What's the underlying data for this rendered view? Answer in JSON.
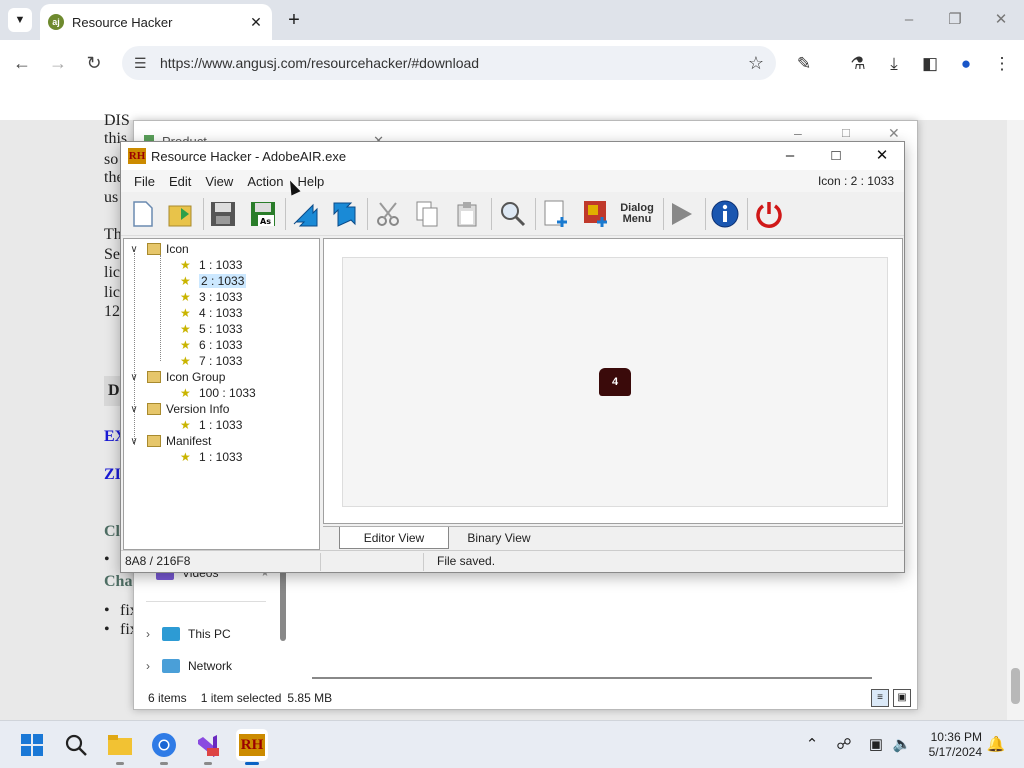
{
  "browser": {
    "tab_title": "Resource Hacker",
    "tab_favicon": "aj",
    "url": "https://www.angusj.com/resourcehacker/#download"
  },
  "page": {
    "lines": [
      "DIS",
      "this",
      "so",
      "the",
      "us",
      "Th",
      "Se",
      "lic",
      "lic",
      "12",
      "D",
      "EX",
      "ZI",
      "Cl",
      "Cha",
      "fix",
      "fix"
    ],
    "bullet": "•"
  },
  "explorer": {
    "partial_tab": "Product",
    "partial_item": "Videos",
    "nav_items": [
      {
        "label": "This PC"
      },
      {
        "label": "Network"
      }
    ],
    "status": {
      "count": "6 items",
      "selected": "1 item selected",
      "size": "5.85 MB"
    }
  },
  "rh": {
    "title": "Resource Hacker - AdobeAIR.exe",
    "logo": "RH",
    "menus": [
      "File",
      "Edit",
      "View",
      "Action",
      "Help"
    ],
    "selection_info": "Icon : 2 : 1033",
    "toolbar_dialog_label": "Dialog Menu",
    "tree": {
      "icon_group": "Icon",
      "icons": [
        "1 : 1033",
        "2 : 1033",
        "3 : 1033",
        "4 : 1033",
        "5 : 1033",
        "6 : 1033",
        "7 : 1033"
      ],
      "icon_group2": "Icon Group",
      "icon_group_items": [
        "100 : 1033"
      ],
      "version": "Version Info",
      "version_items": [
        "1 : 1033"
      ],
      "manifest": "Manifest",
      "manifest_items": [
        "1 : 1033"
      ]
    },
    "view_tabs": [
      "Editor View",
      "Binary View"
    ],
    "status_left": "8A8 / 216F8",
    "status_right": "File saved."
  },
  "taskbar": {
    "time": "10:36 PM",
    "date": "5/17/2024"
  },
  "colors": {
    "accent": "#0a63c4",
    "tab_strip": "#dfe3ea",
    "page_link": "#1a1ad6",
    "page_heading": "#4e6e64"
  }
}
